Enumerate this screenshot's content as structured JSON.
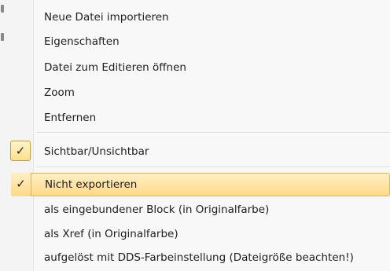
{
  "menu": {
    "group1": [
      {
        "label": "Neue Datei importieren"
      },
      {
        "label": "Eigenschaften"
      },
      {
        "label": "Datei zum Editieren öffnen"
      },
      {
        "label": "Zoom"
      },
      {
        "label": "Entfernen"
      }
    ],
    "group2": [
      {
        "label": "Sichtbar/Unsichtbar",
        "checked": true
      }
    ],
    "group3": [
      {
        "label": "Nicht exportieren",
        "checked": true,
        "highlighted": true
      },
      {
        "label": "als eingebundener Block (in Originalfarbe)"
      },
      {
        "label": "als Xref (in Originalfarbe)"
      },
      {
        "label": "aufgelöst mit DDS-Farbeinstellung (Dateigröße beachten!)"
      }
    ],
    "check_glyph": "✓",
    "colors": {
      "highlight": "#ffd98a",
      "highlight_border": "#e8b34a",
      "background": "#f8f8f8"
    }
  }
}
